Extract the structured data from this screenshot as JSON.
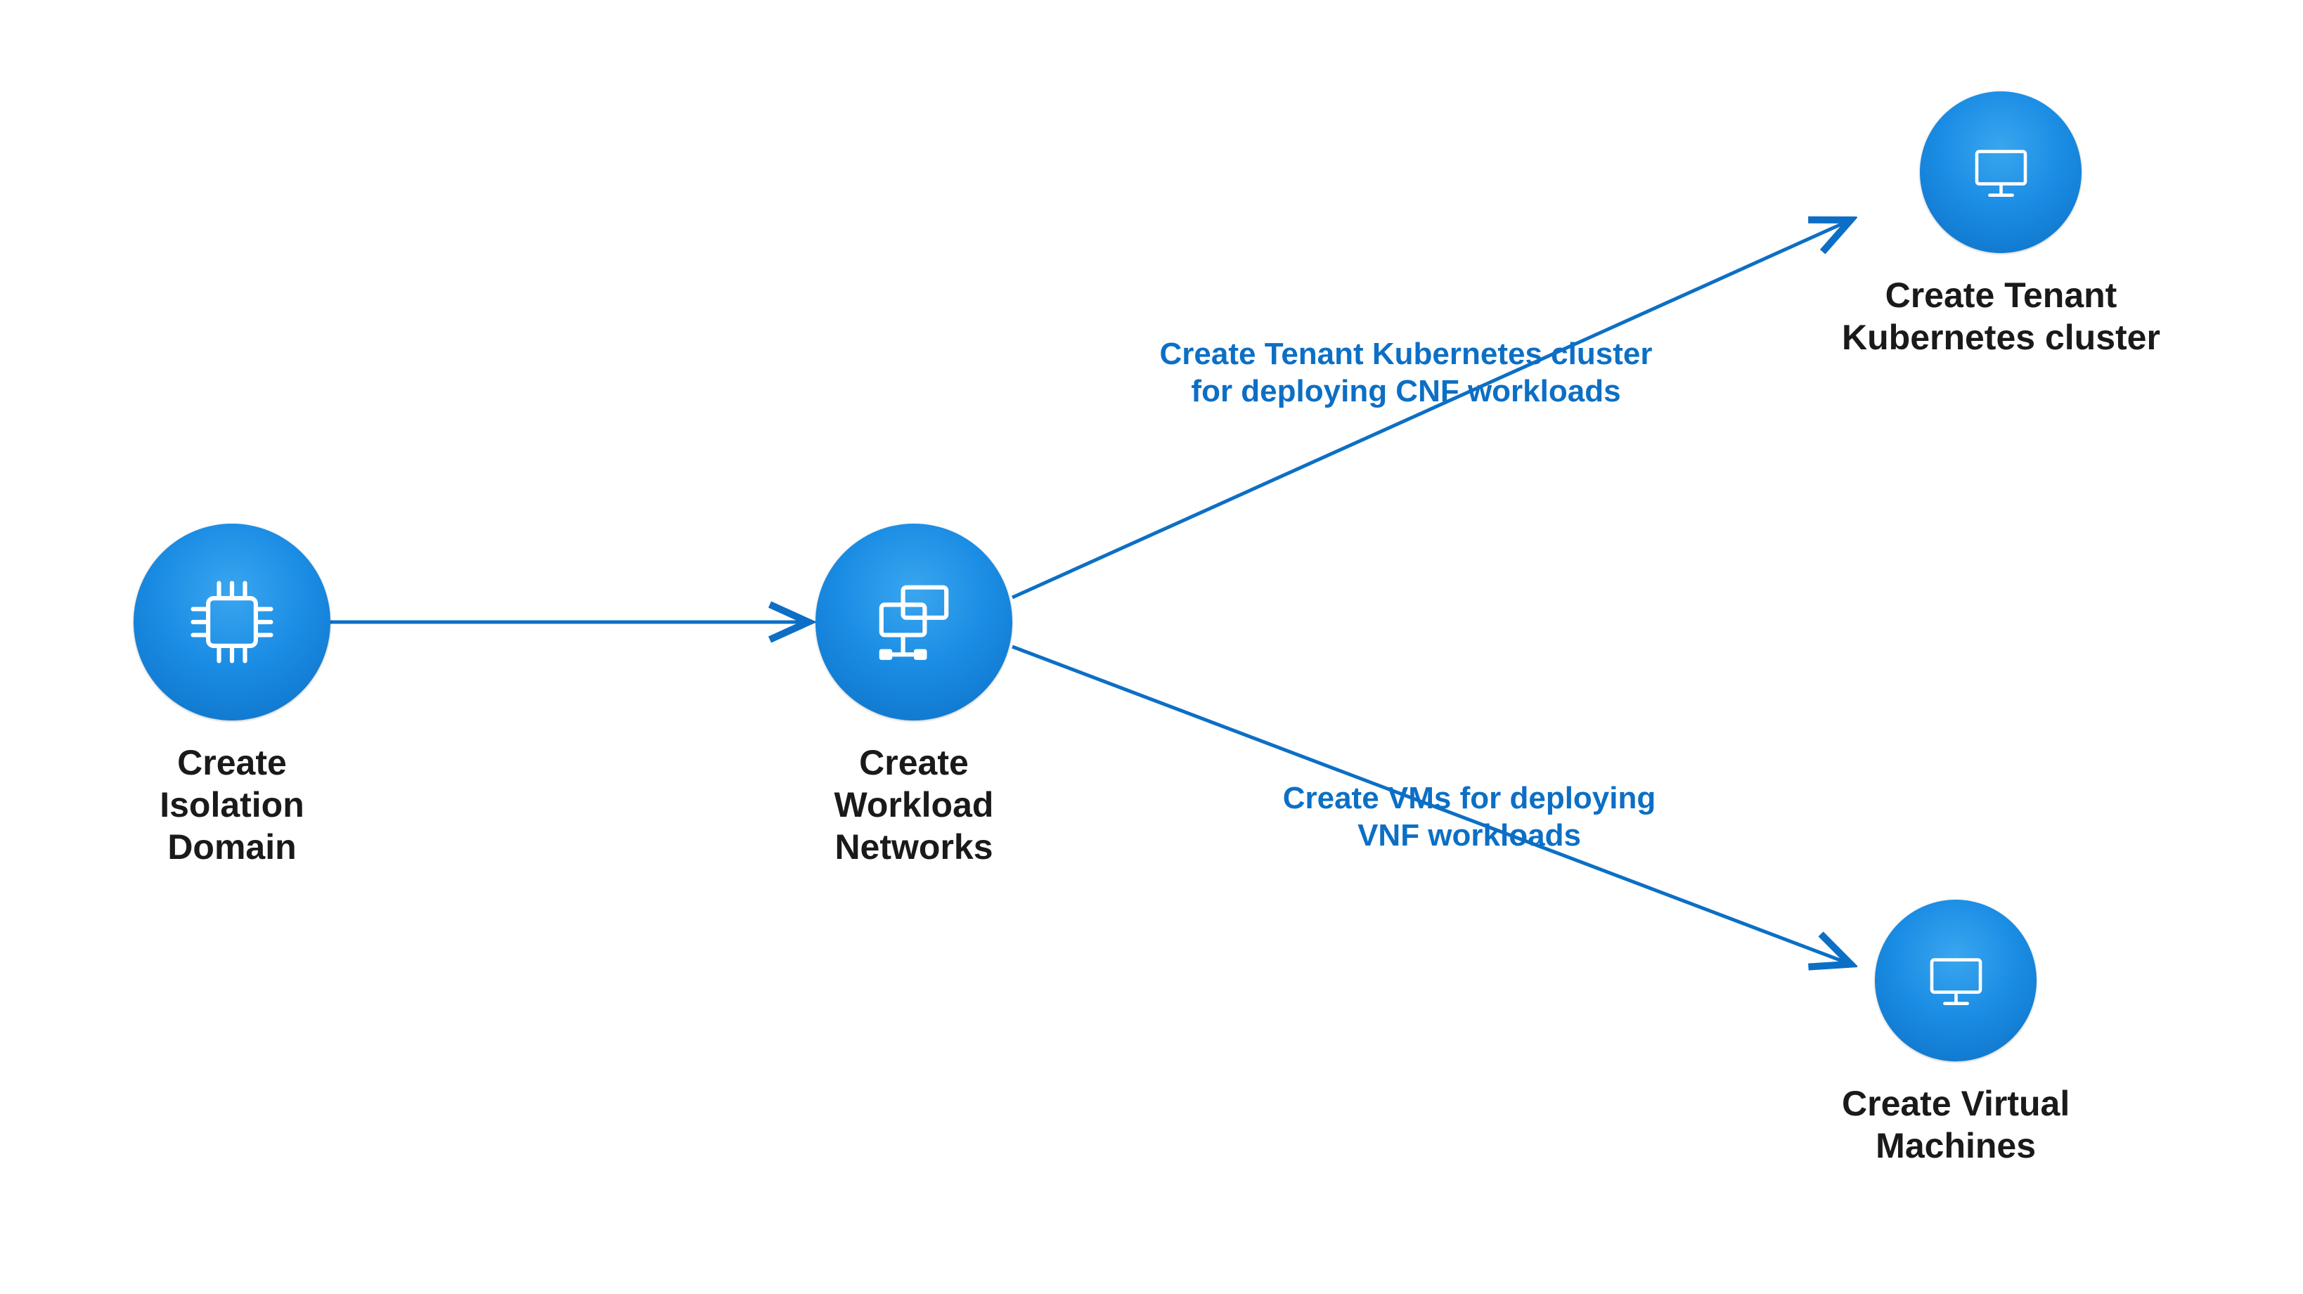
{
  "nodes": {
    "isolation": {
      "label": "Create\nIsolation\nDomain",
      "icon": "chip"
    },
    "workload": {
      "label": "Create\nWorkload\nNetworks",
      "icon": "networked-monitors"
    },
    "kubernetes": {
      "label": "Create Tenant\nKubernetes cluster",
      "icon": "monitor"
    },
    "vms": {
      "label": "Create Virtual\nMachines",
      "icon": "monitor"
    }
  },
  "edges": {
    "iso_to_workload": {
      "label": ""
    },
    "workload_to_kube": {
      "label": "Create Tenant Kubernetes cluster\nfor deploying CNF workloads"
    },
    "workload_to_vm": {
      "label": "Create VMs for deploying\nVNF workloads"
    }
  },
  "colors": {
    "accent": "#0c6fc5",
    "node_gradient_top": "#3aa6ef",
    "node_gradient_bottom": "#0c6fc5",
    "text": "#1a1a1a",
    "background": "#ffffff"
  }
}
